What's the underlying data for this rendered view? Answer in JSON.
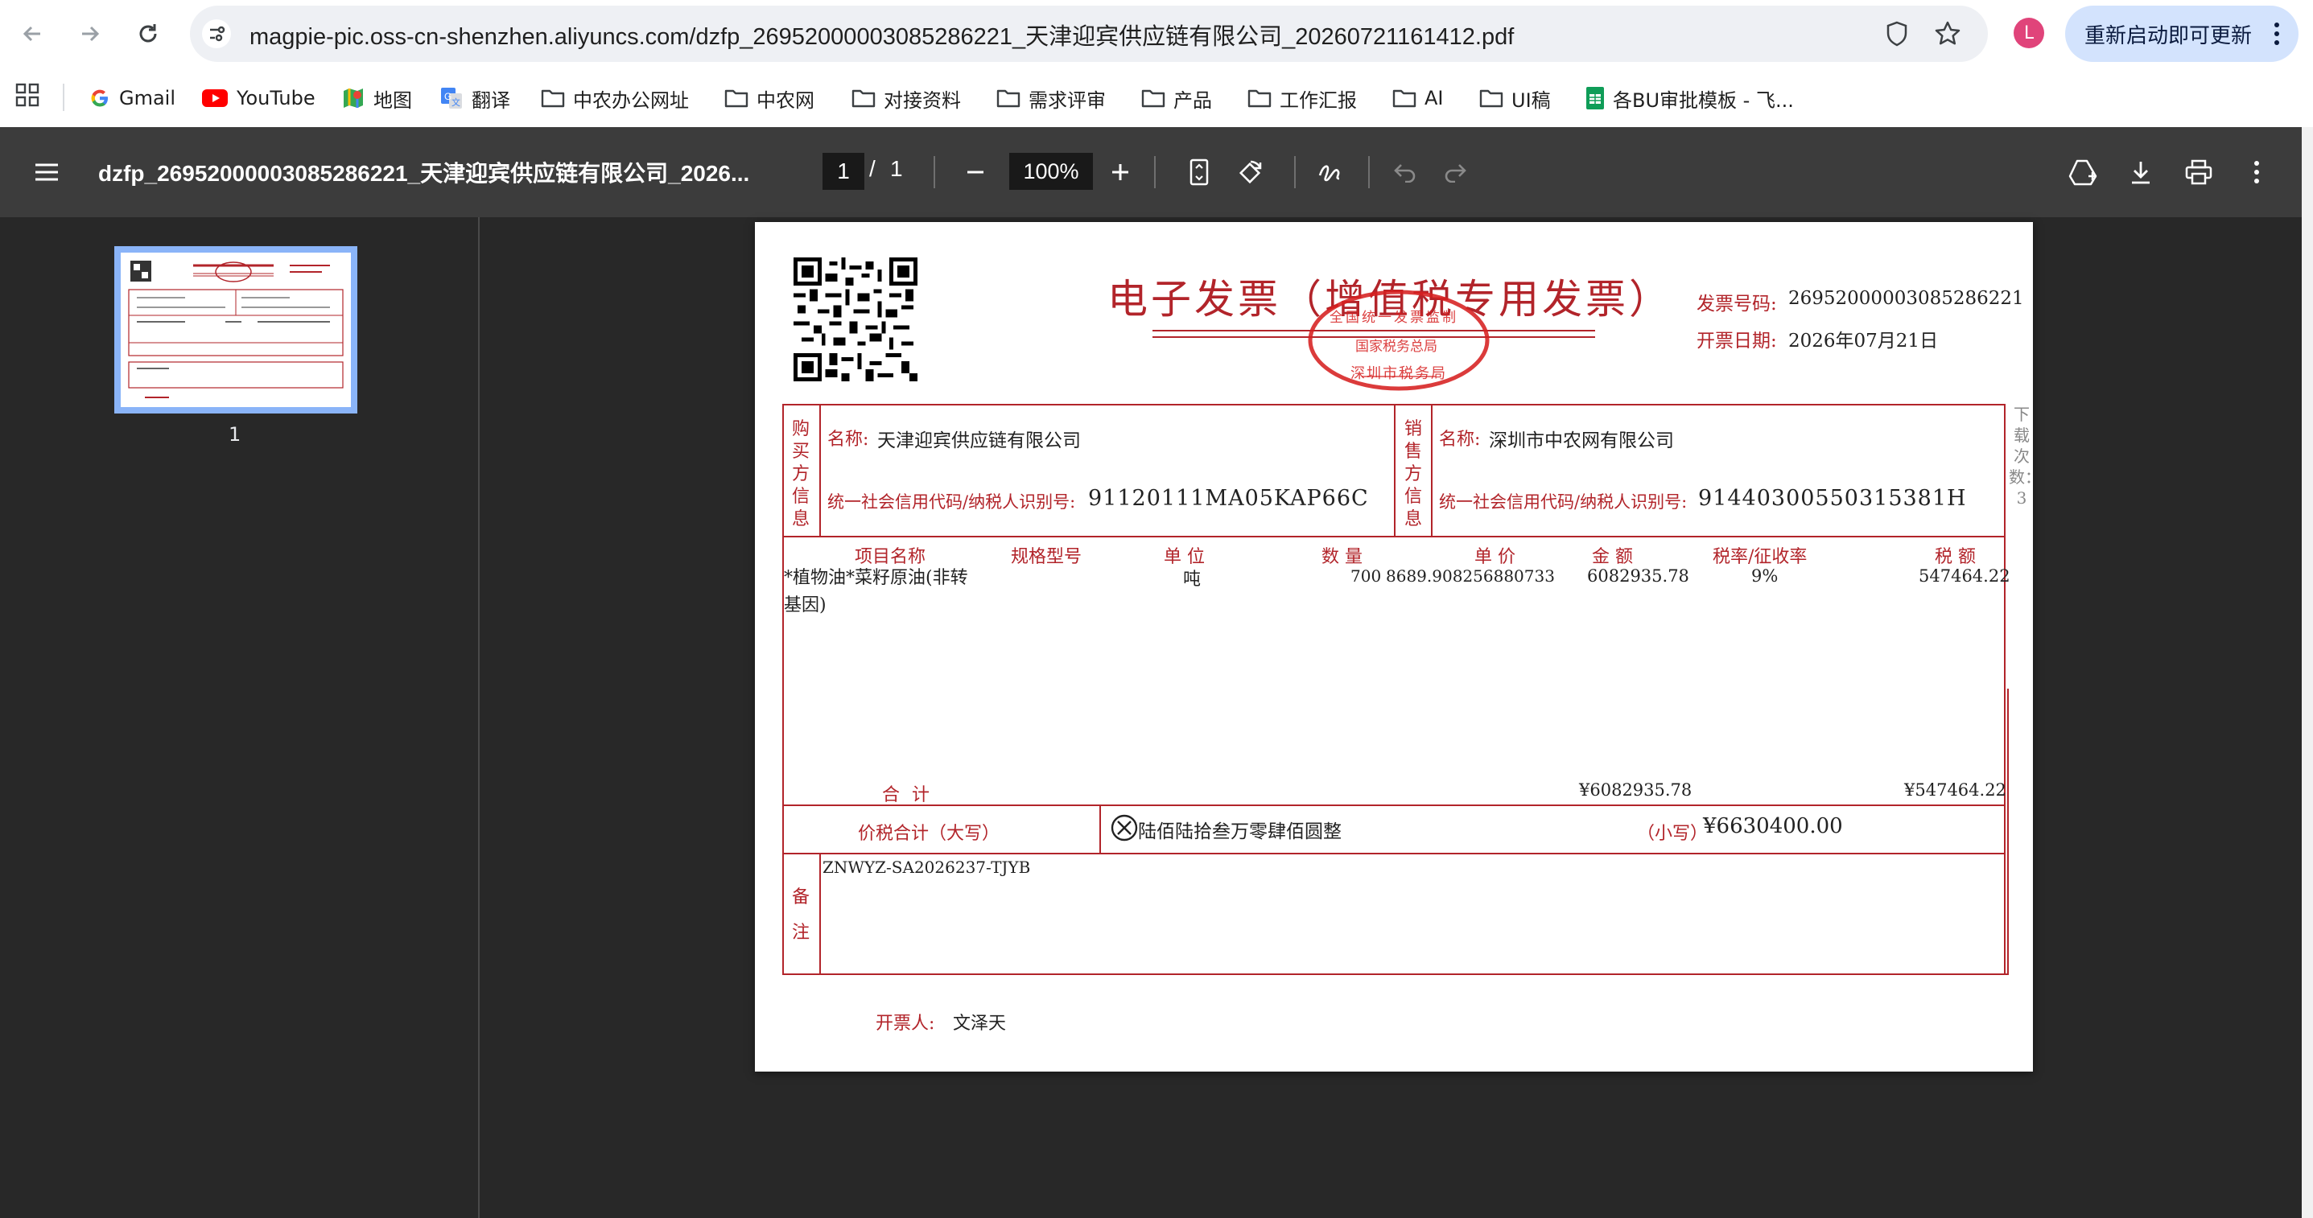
{
  "browser": {
    "url": "magpie-pic.oss-cn-shenzhen.aliyuncs.com/dzfp_26952000003085286221_天津迎宾供应链有限公司_20260721161412.pdf",
    "profile_initial": "L",
    "update_label": "重新启动即可更新",
    "bookmarks": [
      {
        "label": "Gmail",
        "icon": "gmail-icon"
      },
      {
        "label": "YouTube",
        "icon": "youtube-icon"
      },
      {
        "label": "地图",
        "icon": "maps-icon"
      },
      {
        "label": "翻译",
        "icon": "translate-icon"
      },
      {
        "label": "中农办公网址",
        "icon": "folder-icon"
      },
      {
        "label": "中农网",
        "icon": "folder-icon"
      },
      {
        "label": "对接资料",
        "icon": "folder-icon"
      },
      {
        "label": "需求评审",
        "icon": "folder-icon"
      },
      {
        "label": "产品",
        "icon": "folder-icon"
      },
      {
        "label": "工作汇报",
        "icon": "folder-icon"
      },
      {
        "label": "AI",
        "icon": "folder-icon"
      },
      {
        "label": "UI稿",
        "icon": "folder-icon"
      },
      {
        "label": "各BU审批模板 - 飞...",
        "icon": "sheets-icon"
      }
    ]
  },
  "pdf_viewer": {
    "title": "dzfp_26952000003085286221_天津迎宾供应链有限公司_2026...",
    "current_page": "1",
    "page_separator": "/",
    "total_pages": "1",
    "zoom": "100%",
    "thumbnail_label": "1"
  },
  "invoice": {
    "title": "电子发票（增值税专用发票）",
    "seal_text_top": "全国统一发票监制",
    "seal_text_middle": "国家税务总局",
    "seal_text_bottom": "深圳市税务局",
    "invoice_number_label": "发票号码:",
    "invoice_number": "26952000003085286221",
    "issue_date_label": "开票日期:",
    "issue_date": "2026年07月21日",
    "buyer_section_label": "购买方信息",
    "buyer_name_label": "名称:",
    "buyer_name": "天津迎宾供应链有限公司",
    "buyer_tax_label": "统一社会信用代码/纳税人识别号:",
    "buyer_tax_id": "91120111MA05KAP66C",
    "seller_section_label": "销售方信息",
    "seller_name_label": "名称:",
    "seller_name": "深圳市中农网有限公司",
    "seller_tax_label": "统一社会信用代码/纳税人识别号:",
    "seller_tax_id": "91440300550315381H",
    "side_note": "下载次数：3",
    "columns": [
      "项目名称",
      "规格型号",
      "单 位",
      "数 量",
      "单 价",
      "金 额",
      "税率/征收率",
      "税 额"
    ],
    "item": {
      "name_line1": "*植物油*菜籽原油(非转",
      "name_line2": "基因)",
      "spec": "",
      "unit": "吨",
      "quantity": "700",
      "unit_price": "8689.908256880733",
      "amount": "6082935.78",
      "tax_rate": "9%",
      "tax_amount": "547464.22"
    },
    "total_label": "合 计",
    "total_amount": "¥6082935.78",
    "total_tax": "¥547464.22",
    "grand_total_label": "价税合计（大写）",
    "grand_total_words": "陆佰陆拾叁万零肆佰圆整",
    "grand_total_small_label": "（小写）",
    "grand_total": "¥6630400.00",
    "remarks_label": "备注",
    "remarks": "ZNWYZ-SA2026237-TJYB",
    "issuer_label": "开票人:",
    "issuer": "文泽天"
  },
  "colors": {
    "invoice_red": "#b2242a",
    "toolbar_bg": "#3c3c3c",
    "viewer_bg": "#282828",
    "thumb_highlight": "#8ab4f8",
    "update_btn_bg": "#d3e3fd"
  }
}
